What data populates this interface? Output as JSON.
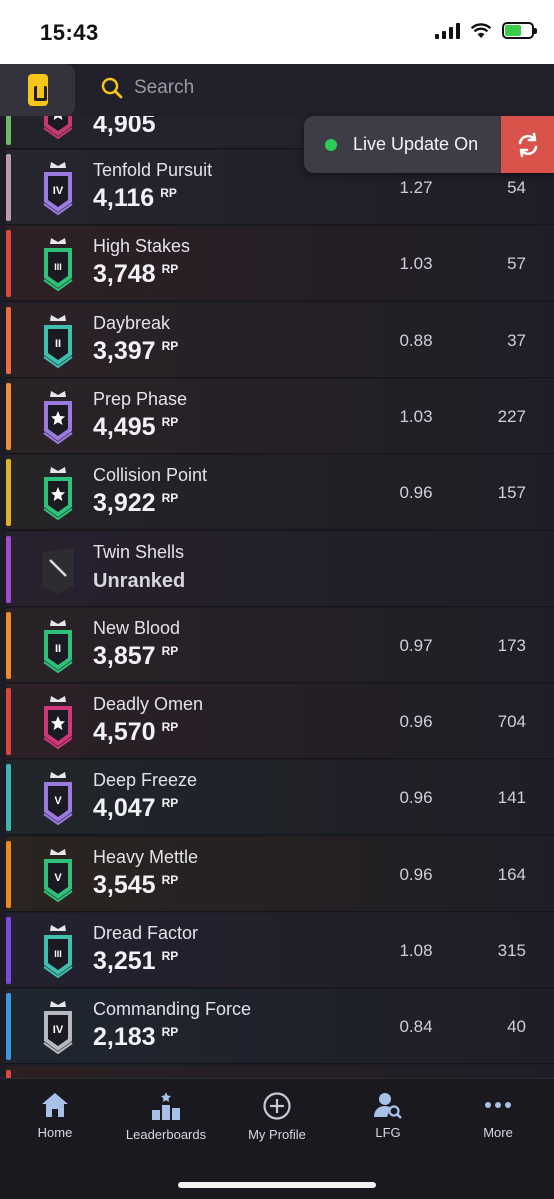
{
  "status_bar": {
    "time": "15:43"
  },
  "header": {
    "search_placeholder": "Search"
  },
  "live_update": {
    "label": "Live Update On"
  },
  "top_partial_row": {
    "rp": "4,905",
    "badge_color": "#c43a6e",
    "accent": "#6fb86a"
  },
  "rows": [
    {
      "name": "Tenfold Pursuit",
      "rp": "4,116",
      "rp_unit": "RP",
      "kd": "1.27",
      "matches": "54",
      "accent": "#b99cb0",
      "tier": "IV",
      "badge_color": "#9b7be0",
      "row_tint": "#262530"
    },
    {
      "name": "High Stakes",
      "rp": "3,748",
      "rp_unit": "RP",
      "kd": "1.03",
      "matches": "57",
      "accent": "#e2483a",
      "tier": "III",
      "badge_color": "#2fc07a",
      "row_tint": "#2d2024"
    },
    {
      "name": "Daybreak",
      "rp": "3,397",
      "rp_unit": "RP",
      "kd": "0.88",
      "matches": "37",
      "accent": "#f06a3c",
      "tier": "II",
      "badge_color": "#3fbfae",
      "row_tint": "#2b2226"
    },
    {
      "name": "Prep Phase",
      "rp": "4,495",
      "rp_unit": "RP",
      "kd": "1.03",
      "matches": "227",
      "accent": "#f0903a",
      "tier": "★",
      "badge_color": "#9b7be0",
      "row_tint": "#2a2326"
    },
    {
      "name": "Collision Point",
      "rp": "3,922",
      "rp_unit": "RP",
      "kd": "0.96",
      "matches": "157",
      "accent": "#e0b22c",
      "tier": "★",
      "badge_color": "#2fc07a",
      "row_tint": "#262427"
    },
    {
      "name": "Twin Shells",
      "rp": "",
      "rp_unit": "",
      "unranked": "Unranked",
      "kd": "",
      "matches": "",
      "accent": "#a24ad0",
      "tier": "",
      "badge_color": "#2a2a2e",
      "row_tint": "#28212f"
    },
    {
      "name": "New Blood",
      "rp": "3,857",
      "rp_unit": "RP",
      "kd": "0.97",
      "matches": "173",
      "accent": "#f08a2c",
      "tier": "II",
      "badge_color": "#2fc07a",
      "row_tint": "#2a2326"
    },
    {
      "name": "Deadly Omen",
      "rp": "4,570",
      "rp_unit": "RP",
      "kd": "0.96",
      "matches": "704",
      "accent": "#e0433a",
      "tier": "★",
      "badge_color": "#d0367c",
      "row_tint": "#2b2025"
    },
    {
      "name": "Deep Freeze",
      "rp": "4,047",
      "rp_unit": "RP",
      "kd": "0.96",
      "matches": "141",
      "accent": "#3fb6b0",
      "tier": "V",
      "badge_color": "#9b7be0",
      "row_tint": "#21262b"
    },
    {
      "name": "Heavy Mettle",
      "rp": "3,545",
      "rp_unit": "RP",
      "kd": "0.96",
      "matches": "164",
      "accent": "#f08a1c",
      "tier": "V",
      "badge_color": "#2fc07a",
      "row_tint": "#2b2420"
    },
    {
      "name": "Dread Factor",
      "rp": "3,251",
      "rp_unit": "RP",
      "kd": "1.08",
      "matches": "315",
      "accent": "#7a4ae0",
      "tier": "III",
      "badge_color": "#3fbfae",
      "row_tint": "#23212f"
    },
    {
      "name": "Commanding Force",
      "rp": "2,183",
      "rp_unit": "RP",
      "kd": "0.84",
      "matches": "40",
      "accent": "#3a9ae0",
      "tier": "IV",
      "badge_color": "#b8b8c0",
      "row_tint": "#1f2630"
    }
  ],
  "bottom_nav": [
    {
      "label": "Home",
      "icon": "home-icon"
    },
    {
      "label": "Leaderboards",
      "icon": "leaderboards-icon"
    },
    {
      "label": "My Profile",
      "icon": "add-circle-icon"
    },
    {
      "label": "LFG",
      "icon": "search-user-icon"
    },
    {
      "label": "More",
      "icon": "more-icon"
    }
  ]
}
